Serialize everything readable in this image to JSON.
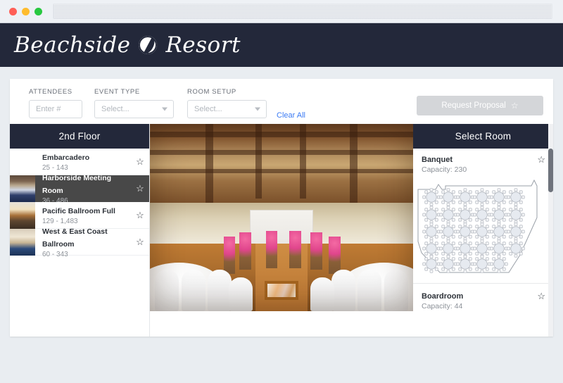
{
  "browser": {
    "url_value": "",
    "traffic_lights": [
      "close-red",
      "minimize-yellow",
      "maximize-green"
    ]
  },
  "header": {
    "brand_first": "Beachside",
    "brand_second": "Resort",
    "logo_icon": "beachball-icon",
    "background": "#23283a"
  },
  "filters": {
    "attendees": {
      "label": "ATTENDEES",
      "placeholder": "Enter #",
      "value": ""
    },
    "event_type": {
      "label": "EVENT TYPE",
      "value": "Select...",
      "icon": "chevron-down-icon"
    },
    "room_setup": {
      "label": "ROOM SETUP",
      "value": "Select...",
      "icon": "chevron-down-icon"
    },
    "clear_all": "Clear All",
    "clear_all_color": "#3d7cf4",
    "request_proposal": {
      "label": "Request Proposal",
      "icon": "star-icon",
      "disabled": true,
      "background": "#d4d6d9"
    }
  },
  "floor_panel": {
    "title": "2nd Floor",
    "rooms": [
      {
        "name": "Embarcadero",
        "capacity": "25 - 143",
        "selected": false,
        "has_thumb": false,
        "star": "☆"
      },
      {
        "name": "Harborside Meeting Room",
        "capacity": "36 - 486",
        "selected": true,
        "has_thumb": true,
        "star": "☆"
      },
      {
        "name": "Pacific Ballroom Full",
        "capacity": "129 - 1,483",
        "selected": false,
        "has_thumb": true,
        "star": "☆"
      },
      {
        "name": "West & East Coast Ballroom",
        "capacity": "60 - 343",
        "selected": false,
        "has_thumb": true,
        "star": "☆"
      }
    ]
  },
  "photo_panel": {
    "alt": "banquet-hall-photo"
  },
  "select_room_panel": {
    "title": "Select Room",
    "setups": [
      {
        "name": "Banquet",
        "capacity_label": "Capacity: 230",
        "star": "☆",
        "has_plan": true
      },
      {
        "name": "Boardroom",
        "capacity_label": "Capacity: 44",
        "star": "☆",
        "has_plan": false
      }
    ],
    "floorplan": {
      "type": "banquet-round-tables",
      "rows": [
        6,
        6,
        6,
        6,
        5
      ],
      "total_tables": 29,
      "seats_per_table": 8,
      "table_fill": "#e6eaf0",
      "outline_color": "#9aa0a8"
    }
  },
  "colors": {
    "page_background": "#e9edf1",
    "card_background": "#ffffff",
    "dark_header": "#23283a",
    "selected_row": "#484848",
    "link_blue": "#3d7cf4"
  }
}
